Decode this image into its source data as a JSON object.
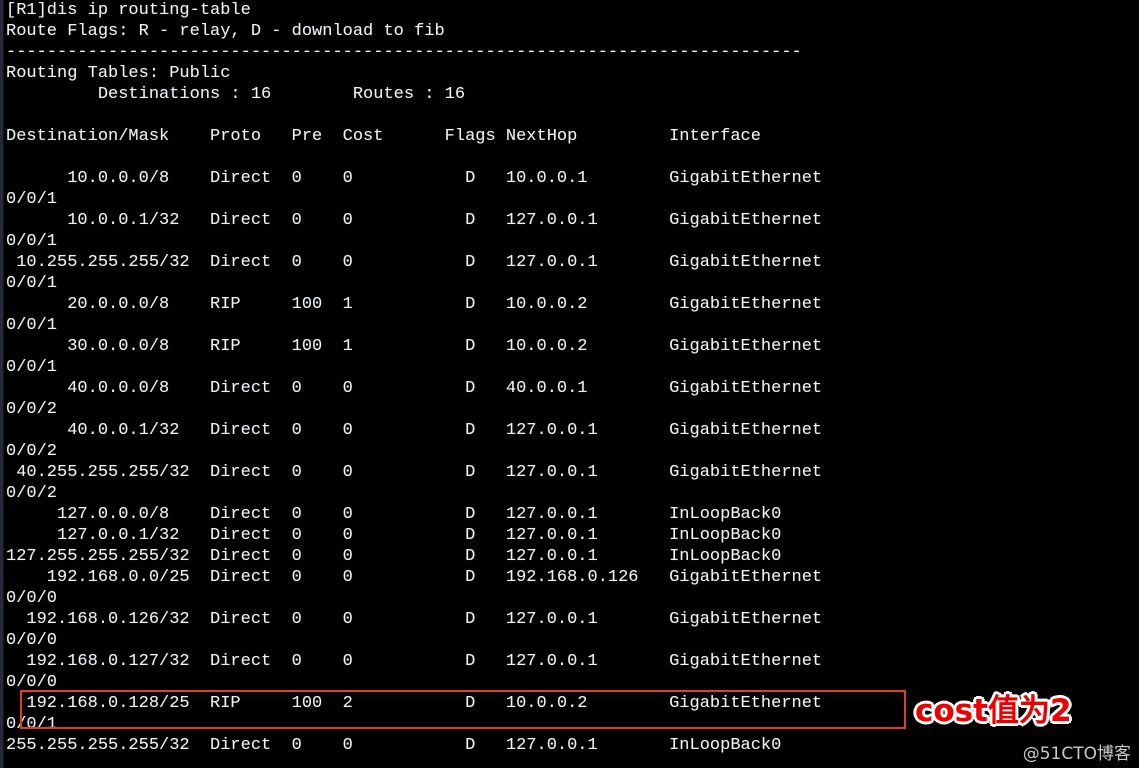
{
  "terminal": {
    "prompt_line": "[R1]dis ip routing-table",
    "flags_line": "Route Flags: R - relay, D - download to fib",
    "separator": "------------------------------------------------------------------------------",
    "tables_line": "Routing Tables: Public",
    "counts_line": "         Destinations : 16        Routes : 16",
    "header_line": "Destination/Mask    Proto   Pre  Cost      Flags NextHop         Interface"
  },
  "columns": {
    "destination": "Destination/Mask",
    "proto": "Proto",
    "pre": "Pre",
    "cost": "Cost",
    "flags": "Flags",
    "nexthop": "NextHop",
    "interface": "Interface"
  },
  "summary": {
    "table_name": "Public",
    "destinations_label": "Destinations",
    "destinations": "16",
    "routes_label": "Routes",
    "routes": "16"
  },
  "routes": [
    {
      "dest": "10.0.0.0/8",
      "proto": "Direct",
      "pre": "0",
      "cost": "0",
      "flags": "D",
      "nexthop": "10.0.0.1",
      "interface": "GigabitEthernet",
      "interface_wrap": "0/0/1"
    },
    {
      "dest": "10.0.0.1/32",
      "proto": "Direct",
      "pre": "0",
      "cost": "0",
      "flags": "D",
      "nexthop": "127.0.0.1",
      "interface": "GigabitEthernet",
      "interface_wrap": "0/0/1"
    },
    {
      "dest": "10.255.255.255/32",
      "proto": "Direct",
      "pre": "0",
      "cost": "0",
      "flags": "D",
      "nexthop": "127.0.0.1",
      "interface": "GigabitEthernet",
      "interface_wrap": "0/0/1"
    },
    {
      "dest": "20.0.0.0/8",
      "proto": "RIP",
      "pre": "100",
      "cost": "1",
      "flags": "D",
      "nexthop": "10.0.0.2",
      "interface": "GigabitEthernet",
      "interface_wrap": "0/0/1"
    },
    {
      "dest": "30.0.0.0/8",
      "proto": "RIP",
      "pre": "100",
      "cost": "1",
      "flags": "D",
      "nexthop": "10.0.0.2",
      "interface": "GigabitEthernet",
      "interface_wrap": "0/0/1"
    },
    {
      "dest": "40.0.0.0/8",
      "proto": "Direct",
      "pre": "0",
      "cost": "0",
      "flags": "D",
      "nexthop": "40.0.0.1",
      "interface": "GigabitEthernet",
      "interface_wrap": "0/0/2"
    },
    {
      "dest": "40.0.0.1/32",
      "proto": "Direct",
      "pre": "0",
      "cost": "0",
      "flags": "D",
      "nexthop": "127.0.0.1",
      "interface": "GigabitEthernet",
      "interface_wrap": "0/0/2"
    },
    {
      "dest": "40.255.255.255/32",
      "proto": "Direct",
      "pre": "0",
      "cost": "0",
      "flags": "D",
      "nexthop": "127.0.0.1",
      "interface": "GigabitEthernet",
      "interface_wrap": "0/0/2"
    },
    {
      "dest": "127.0.0.0/8",
      "proto": "Direct",
      "pre": "0",
      "cost": "0",
      "flags": "D",
      "nexthop": "127.0.0.1",
      "interface": "InLoopBack0",
      "interface_wrap": ""
    },
    {
      "dest": "127.0.0.1/32",
      "proto": "Direct",
      "pre": "0",
      "cost": "0",
      "flags": "D",
      "nexthop": "127.0.0.1",
      "interface": "InLoopBack0",
      "interface_wrap": ""
    },
    {
      "dest": "127.255.255.255/32",
      "proto": "Direct",
      "pre": "0",
      "cost": "0",
      "flags": "D",
      "nexthop": "127.0.0.1",
      "interface": "InLoopBack0",
      "interface_wrap": ""
    },
    {
      "dest": "192.168.0.0/25",
      "proto": "Direct",
      "pre": "0",
      "cost": "0",
      "flags": "D",
      "nexthop": "192.168.0.126",
      "interface": "GigabitEthernet",
      "interface_wrap": "0/0/0"
    },
    {
      "dest": "192.168.0.126/32",
      "proto": "Direct",
      "pre": "0",
      "cost": "0",
      "flags": "D",
      "nexthop": "127.0.0.1",
      "interface": "GigabitEthernet",
      "interface_wrap": "0/0/0"
    },
    {
      "dest": "192.168.0.127/32",
      "proto": "Direct",
      "pre": "0",
      "cost": "0",
      "flags": "D",
      "nexthop": "127.0.0.1",
      "interface": "GigabitEthernet",
      "interface_wrap": "0/0/0"
    },
    {
      "dest": "192.168.0.128/25",
      "proto": "RIP",
      "pre": "100",
      "cost": "2",
      "flags": "D",
      "nexthop": "10.0.0.2",
      "interface": "GigabitEthernet",
      "interface_wrap": "0/0/1"
    },
    {
      "dest": "255.255.255.255/32",
      "proto": "Direct",
      "pre": "0",
      "cost": "0",
      "flags": "D",
      "nexthop": "127.0.0.1",
      "interface": "InLoopBack0",
      "interface_wrap": ""
    }
  ],
  "console_lines": [
    "[R1]dis ip routing-table",
    "Route Flags: R - relay, D - download to fib",
    "------------------------------------------------------------------------------",
    "Routing Tables: Public",
    "         Destinations : 16        Routes : 16",
    "",
    "Destination/Mask    Proto   Pre  Cost      Flags NextHop         Interface",
    "",
    "      10.0.0.0/8    Direct  0    0           D   10.0.0.1        GigabitEthernet",
    "0/0/1",
    "      10.0.0.1/32   Direct  0    0           D   127.0.0.1       GigabitEthernet",
    "0/0/1",
    " 10.255.255.255/32  Direct  0    0           D   127.0.0.1       GigabitEthernet",
    "0/0/1",
    "      20.0.0.0/8    RIP     100  1           D   10.0.0.2        GigabitEthernet",
    "0/0/1",
    "      30.0.0.0/8    RIP     100  1           D   10.0.0.2        GigabitEthernet",
    "0/0/1",
    "      40.0.0.0/8    Direct  0    0           D   40.0.0.1        GigabitEthernet",
    "0/0/2",
    "      40.0.0.1/32   Direct  0    0           D   127.0.0.1       GigabitEthernet",
    "0/0/2",
    " 40.255.255.255/32  Direct  0    0           D   127.0.0.1       GigabitEthernet",
    "0/0/2",
    "     127.0.0.0/8    Direct  0    0           D   127.0.0.1       InLoopBack0",
    "     127.0.0.1/32   Direct  0    0           D   127.0.0.1       InLoopBack0",
    "127.255.255.255/32  Direct  0    0           D   127.0.0.1       InLoopBack0",
    "    192.168.0.0/25  Direct  0    0           D   192.168.0.126   GigabitEthernet",
    "0/0/0",
    "  192.168.0.126/32  Direct  0    0           D   127.0.0.1       GigabitEthernet",
    "0/0/0",
    "  192.168.0.127/32  Direct  0    0           D   127.0.0.1       GigabitEthernet",
    "0/0/0",
    "  192.168.0.128/25  RIP     100  2           D   10.0.0.2        GigabitEthernet",
    "0/0/1",
    "255.255.255.255/32  Direct  0    0           D   127.0.0.1       InLoopBack0"
  ],
  "annotation": {
    "text": "cost值为2",
    "color": "#ee0000",
    "outline_color": "#ffffff"
  },
  "highlight": {
    "border_color": "#e23b32",
    "target_route": "192.168.0.128/25"
  },
  "watermark": {
    "text": "@51CTO博客",
    "color": "#c9c9c9"
  }
}
